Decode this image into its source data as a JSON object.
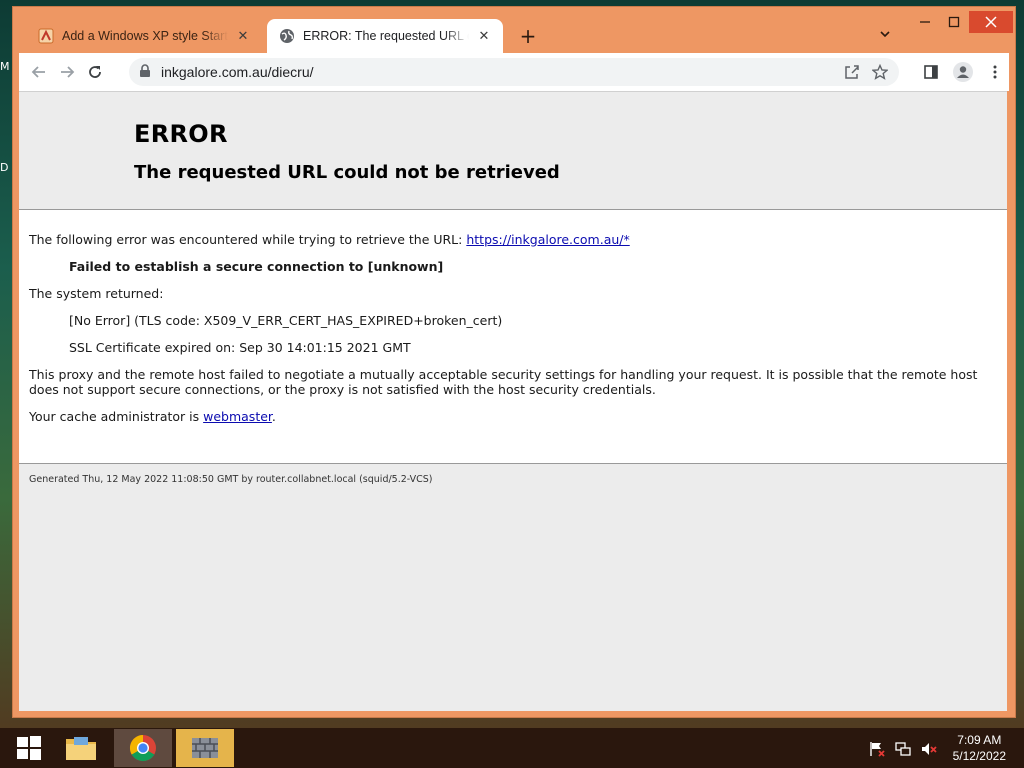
{
  "desktop": {
    "edge_letters": [
      "M",
      "D"
    ]
  },
  "browser": {
    "tabs": [
      {
        "title": "Add a Windows XP style Start Me",
        "active": false,
        "favicon": "ink-favicon-icon"
      },
      {
        "title": "ERROR: The requested URL could not be retrieved",
        "active": true,
        "favicon": "globe-icon"
      }
    ],
    "new_tab": "+",
    "url": "inkgalore.com.au/diecru/"
  },
  "page": {
    "heading": "ERROR",
    "subheading": "The requested URL could not be retrieved",
    "intro_text": "The following error was encountered while trying to retrieve the URL: ",
    "intro_link": "https://inkgalore.com.au/*",
    "error_line": "Failed to establish a secure connection to [unknown]",
    "system_returned": "The system returned:",
    "tls_code": "[No Error] (TLS code: X509_V_ERR_CERT_HAS_EXPIRED+broken_cert)",
    "ssl_expired": "SSL Certificate expired on: Sep 30 14:01:15 2021 GMT",
    "explanation": "This proxy and the remote host failed to negotiate a mutually acceptable security settings for handling your request. It is possible that the remote host does not support secure connections, or the proxy is not satisfied with the host security credentials.",
    "admin_prefix": "Your cache administrator is ",
    "admin_link": "webmaster",
    "admin_suffix": ".",
    "footer": "Generated Thu, 12 May 2022 11:08:50 GMT by router.collabnet.local (squid/5.2-VCS)"
  },
  "taskbar": {
    "time": "7:09 AM",
    "date": "5/12/2022"
  }
}
